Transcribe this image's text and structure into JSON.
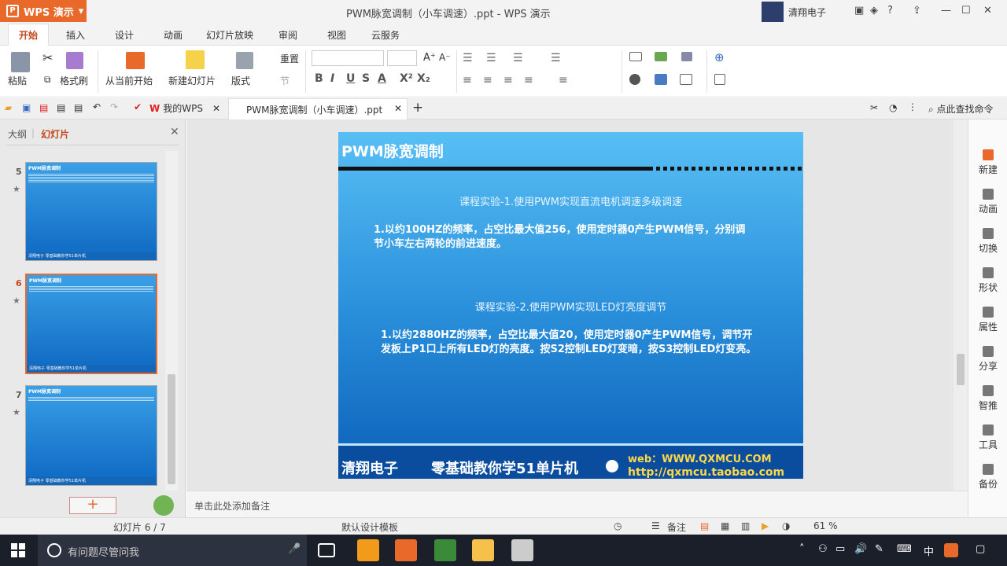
{
  "app": {
    "name": "WPS 演示",
    "window_title": "PWM脉宽调制（小车调速）.ppt - WPS 演示",
    "user": "清翔电子"
  },
  "menu_tabs": [
    "开始",
    "插入",
    "设计",
    "动画",
    "幻灯片放映",
    "审阅",
    "视图",
    "云服务"
  ],
  "ribbon": {
    "paste": "粘贴",
    "format_painter": "格式刷",
    "from_current": "从当前开始",
    "new_slide": "新建幻灯片",
    "layout": "版式",
    "reset": "重置",
    "section": "节"
  },
  "doc_tabs": {
    "my_wps": "我的WPS",
    "file": "PWM脉宽调制（小车调速）.ppt",
    "search": "点此查找命令"
  },
  "panel": {
    "outline_tab": "大纲",
    "slides_tab": "幻灯片",
    "add": "+"
  },
  "thumbs": [
    {
      "num": "5",
      "title": "PWM脉宽调制",
      "foot": "清翔电子   零基础教你学51单片机"
    },
    {
      "num": "6",
      "title": "PWM脉宽调制",
      "foot": "清翔电子   零基础教你学51单片机"
    },
    {
      "num": "7",
      "title": "PWM脉宽调制",
      "foot": "清翔电子   零基础教你学51单片机"
    }
  ],
  "slide": {
    "title": "PWM脉宽调制",
    "exp1_heading": "课程实验-1.使用PWM实现直流电机调速多级调速",
    "exp1_text": "1.以约100HZ的频率，占空比最大值256，使用定时器0产生PWM信号，分别调节小车左右两轮的前进速度。",
    "exp2_heading": "课程实验-2.使用PWM实现LED灯亮度调节",
    "exp2_text": "1.以约2880HZ的频率，占空比最大值20，使用定时器0产生PWM信号，调节开发板上P1口上所有LED灯的亮度。按S2控制LED灯变暗，按S3控制LED灯变亮。",
    "footer_brand": "清翔电子",
    "footer_slogan": "零基础教你学51单片机",
    "footer_web": "web：WWW.QXMCU.COM",
    "footer_url": "http://qxmcu.taobao.com"
  },
  "notes_placeholder": "单击此处添加备注",
  "right_side": [
    "新建",
    "动画",
    "切换",
    "形状",
    "属性",
    "分享",
    "智推",
    "工具",
    "备份"
  ],
  "status": {
    "slide_pos": "幻灯片 6 / 7",
    "template": "默认设计模板",
    "notes": "备注",
    "zoom": "61 %"
  },
  "taskbar": {
    "search_placeholder": "有问题尽管问我",
    "ime": "中"
  }
}
